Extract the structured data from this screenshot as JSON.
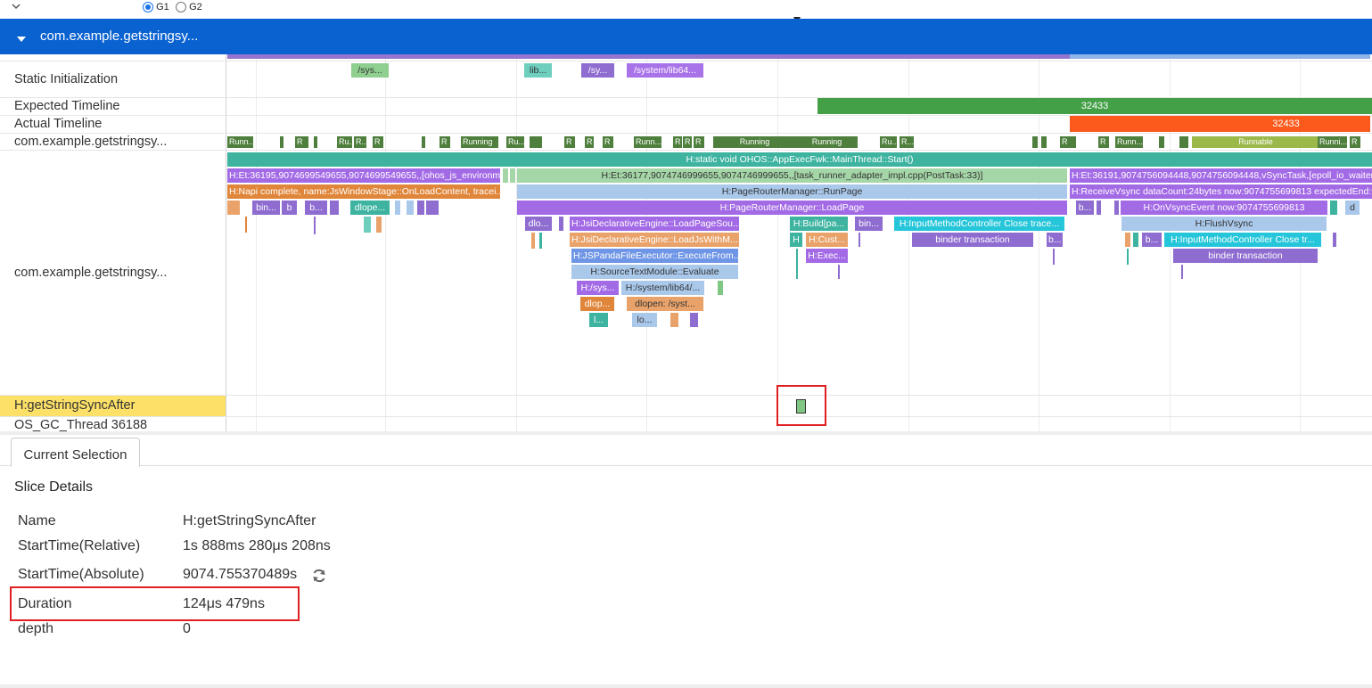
{
  "top": {
    "radio_g1": "G1",
    "radio_g2": "G2"
  },
  "process_header": {
    "title": "com.example.getstringsy..."
  },
  "rows": {
    "static_init": "Static Initialization",
    "expected_timeline": "Expected Timeline",
    "actual_timeline": "Actual Timeline",
    "thread_state": "com.example.getstringsy...",
    "main_thread": "com.example.getstringsy...",
    "selected_row": "H:getStringSyncAfter",
    "gc_thread": "OS_GC_Thread 36188"
  },
  "static_slices": [
    "/sys...",
    "lib...",
    "/sy...",
    "/system/lib64..."
  ],
  "frames": {
    "expected": "32433",
    "actual": "32433"
  },
  "states": [
    "Runn...",
    "R",
    "Ru...",
    "R...",
    "R",
    "R",
    "Running",
    "Ru...",
    "R",
    "R",
    "R",
    "Runn...",
    "R",
    "R",
    "R",
    "Running",
    "Running",
    "Ru...",
    "R...",
    "R",
    "R",
    "Runn...",
    "Runnable",
    "Runni...",
    "R"
  ],
  "slices": {
    "d0": "H:static void OHOS::AppExecFwk::MainThread::Start()",
    "d1a": "H:Et:36195,9074699549655,9074699549655,,[ohos_js_environme...",
    "d1b": "H:Et:36177,9074746999655,9074746999655,,[task_runner_adapter_impl.cpp(PostTask:33)]",
    "d1c": "H:Et:36191,9074756094448,9074756094448,vSyncTask,[epoll_io_waiter...",
    "d2a": "H:Napi complete, name:JsWindowStage::OnLoadContent, tracei...",
    "d2b": "H:PageRouterManager::RunPage",
    "d2c": "H:ReceiveVsync dataCount:24bytes now:9074755699813 expectedEnd:9...",
    "d3a": "bin...",
    "d3b": "b",
    "d3c": "b...",
    "d3d": "dlope...",
    "d3e": "H:PageRouterManager::LoadPage",
    "d3f": "b...",
    "d3g": "H:OnVsyncEvent now:9074755699813",
    "d3h": "d",
    "d4a": "dlo...",
    "d4b": "H:JsiDeclarativeEngine::LoadPageSou...",
    "d4c": "H:Build[pa...",
    "d4d": "bin...",
    "d4e": "H:InputMethodController Close trace...",
    "d4f": "H:FlushVsync",
    "d5a": "H:JsiDeclarativeEngine::LoadJsWithM...",
    "d5b": "H",
    "d5c": "H:Cust...",
    "d5d": "binder transaction",
    "d5e": "b...",
    "d5f": "b...",
    "d5g": "H:InputMethodController Close tr...",
    "d6a": "H:JSPandaFileExecutor::ExecuteFrom...",
    "d6b": "H:Exec...",
    "d6c": "binder transaction",
    "d7a": "H:SourceTextModule::Evaluate",
    "d8a": "H:/sys...",
    "d8b": "H:/system/lib64/...",
    "d9a": "dlop...",
    "d9b": "dlopen:  /syst...",
    "d10a": "l...",
    "d10b": "lo..."
  },
  "tab": {
    "current_selection": "Current Selection"
  },
  "details": {
    "heading": "Slice Details",
    "rows": [
      {
        "label": "Name",
        "value": "H:getStringSyncAfter"
      },
      {
        "label": "StartTime(Relative)",
        "value": "1s 888ms 280μs 208ns"
      },
      {
        "label": "StartTime(Absolute)",
        "value": "9074.755370489s"
      },
      {
        "label": "Duration",
        "value": "124μs 479ns"
      },
      {
        "label": "depth",
        "value": "0"
      }
    ]
  },
  "colors": {
    "header_blue": "#0a62d0",
    "selected_row": "#fde068",
    "highlight_red": "#e02020",
    "expected_green": "#43a047",
    "actual_orange": "#fb5a1c",
    "running_green": "#4e7f3c"
  }
}
